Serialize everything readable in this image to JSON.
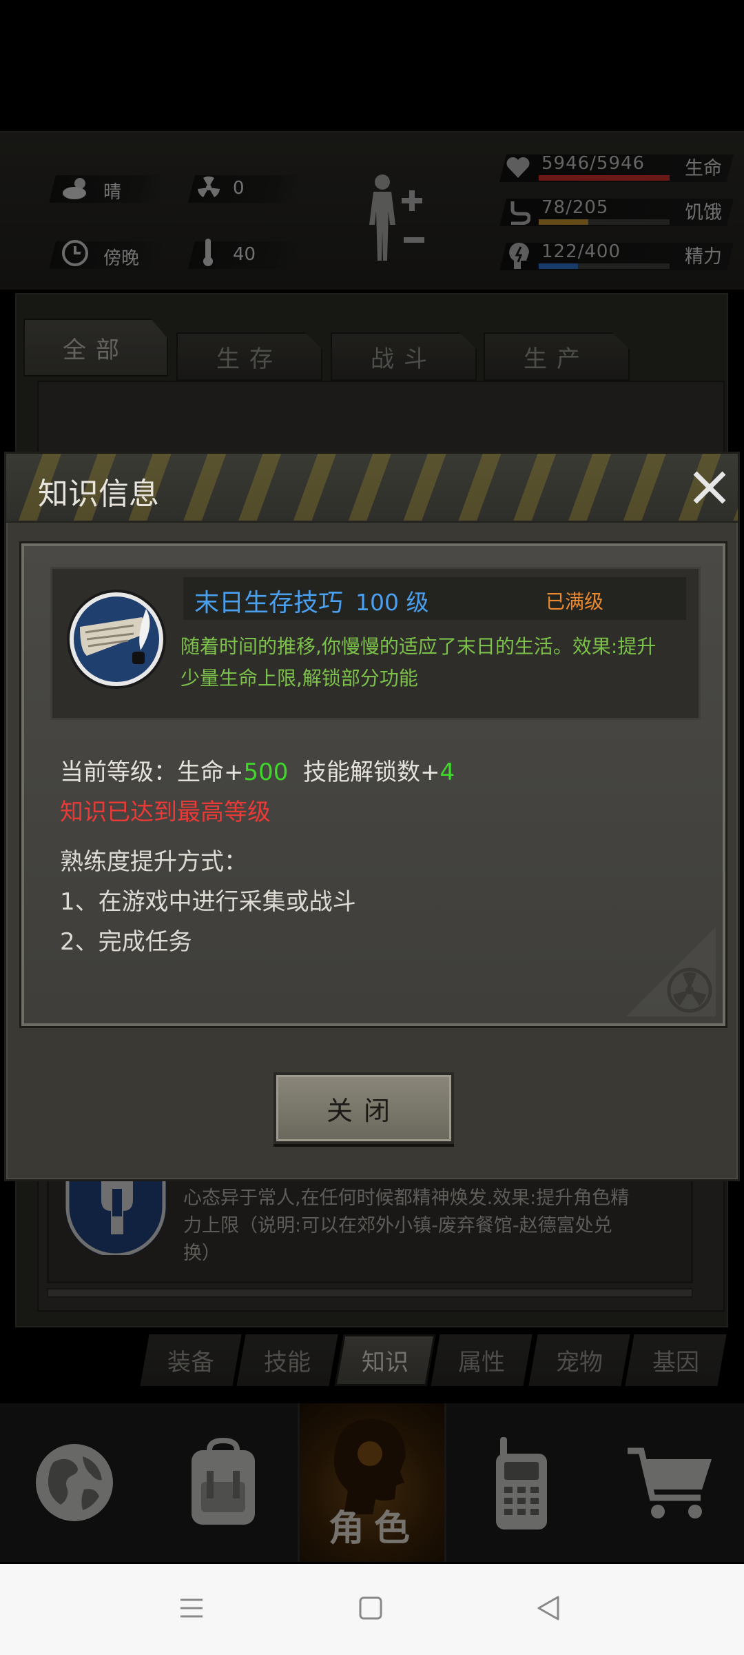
{
  "status": {
    "weather": "晴",
    "radiation": "0",
    "time_of_day": "傍晚",
    "temperature": "40"
  },
  "vitals": [
    {
      "label": "生命",
      "value": "5946/5946",
      "fill": 1.0,
      "color": "#c0302a"
    },
    {
      "label": "饥饿",
      "value": "78/205",
      "fill": 0.38,
      "color": "#b7892a"
    },
    {
      "label": "精力",
      "value": "122/400",
      "fill": 0.3,
      "color": "#2e6cc2"
    }
  ],
  "category_tabs": [
    "全部",
    "生存",
    "战斗",
    "生产"
  ],
  "dialog": {
    "title": "知识信息",
    "skill_name": "末日生存技巧",
    "skill_level": "100 级",
    "skill_max": "已满级",
    "skill_desc": "随着时间的推移,你慢慢的适应了末日的生活。效果:提升少量生命上限,解锁部分功能",
    "effect_prefix": "当前等级：生命+",
    "effect_hp": "500",
    "effect_mid": "  技能解锁数+",
    "effect_unlock": "4",
    "max_note": "知识已达到最高等级",
    "method_title": "熟练度提升方式：",
    "method_1": "1、在游戏中进行采集或战斗",
    "method_2": "2、完成任务",
    "close_label": "关闭"
  },
  "peek_item": {
    "desc": "心态异于常人,在任何时候都精神焕发.效果:提升角色精力上限（说明:可以在郊外小镇-废弃餐馆-赵德富处兑换）"
  },
  "sub_tabs": [
    "装备",
    "技能",
    "知识",
    "属性",
    "宠物",
    "基因"
  ],
  "sub_tab_active": "知识",
  "main_nav": {
    "active_label": "角色",
    "icons": [
      "globe-icon",
      "backpack-icon",
      "character-head-icon",
      "walkie-talkie-icon",
      "cart-icon"
    ]
  }
}
